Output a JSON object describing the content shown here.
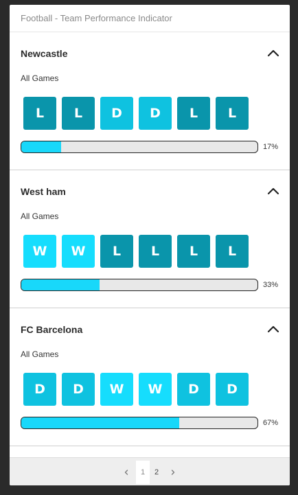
{
  "header": {
    "title": "Football - Team Performance Indicator"
  },
  "teams": [
    {
      "name": "Newcastle",
      "games_label": "All Games",
      "results": [
        "L",
        "L",
        "D",
        "D",
        "L",
        "L"
      ],
      "percent_value": 17,
      "percent_label": "17%"
    },
    {
      "name": "West ham",
      "games_label": "All Games",
      "results": [
        "W",
        "W",
        "L",
        "L",
        "L",
        "L"
      ],
      "percent_value": 33,
      "percent_label": "33%"
    },
    {
      "name": "FC Barcelona",
      "games_label": "All Games",
      "results": [
        "D",
        "D",
        "W",
        "W",
        "D",
        "D"
      ],
      "percent_value": 67,
      "percent_label": "67%"
    }
  ],
  "pagination": {
    "prev_icon": "chevron-left-icon",
    "next_icon": "chevron-right-icon",
    "pages": [
      "1",
      "2"
    ],
    "current_page": "1"
  },
  "colors": {
    "loss": "#0a95ab",
    "draw": "#0fc2e0",
    "win": "#16ddfd",
    "bar_fill": "#18d8fa"
  }
}
